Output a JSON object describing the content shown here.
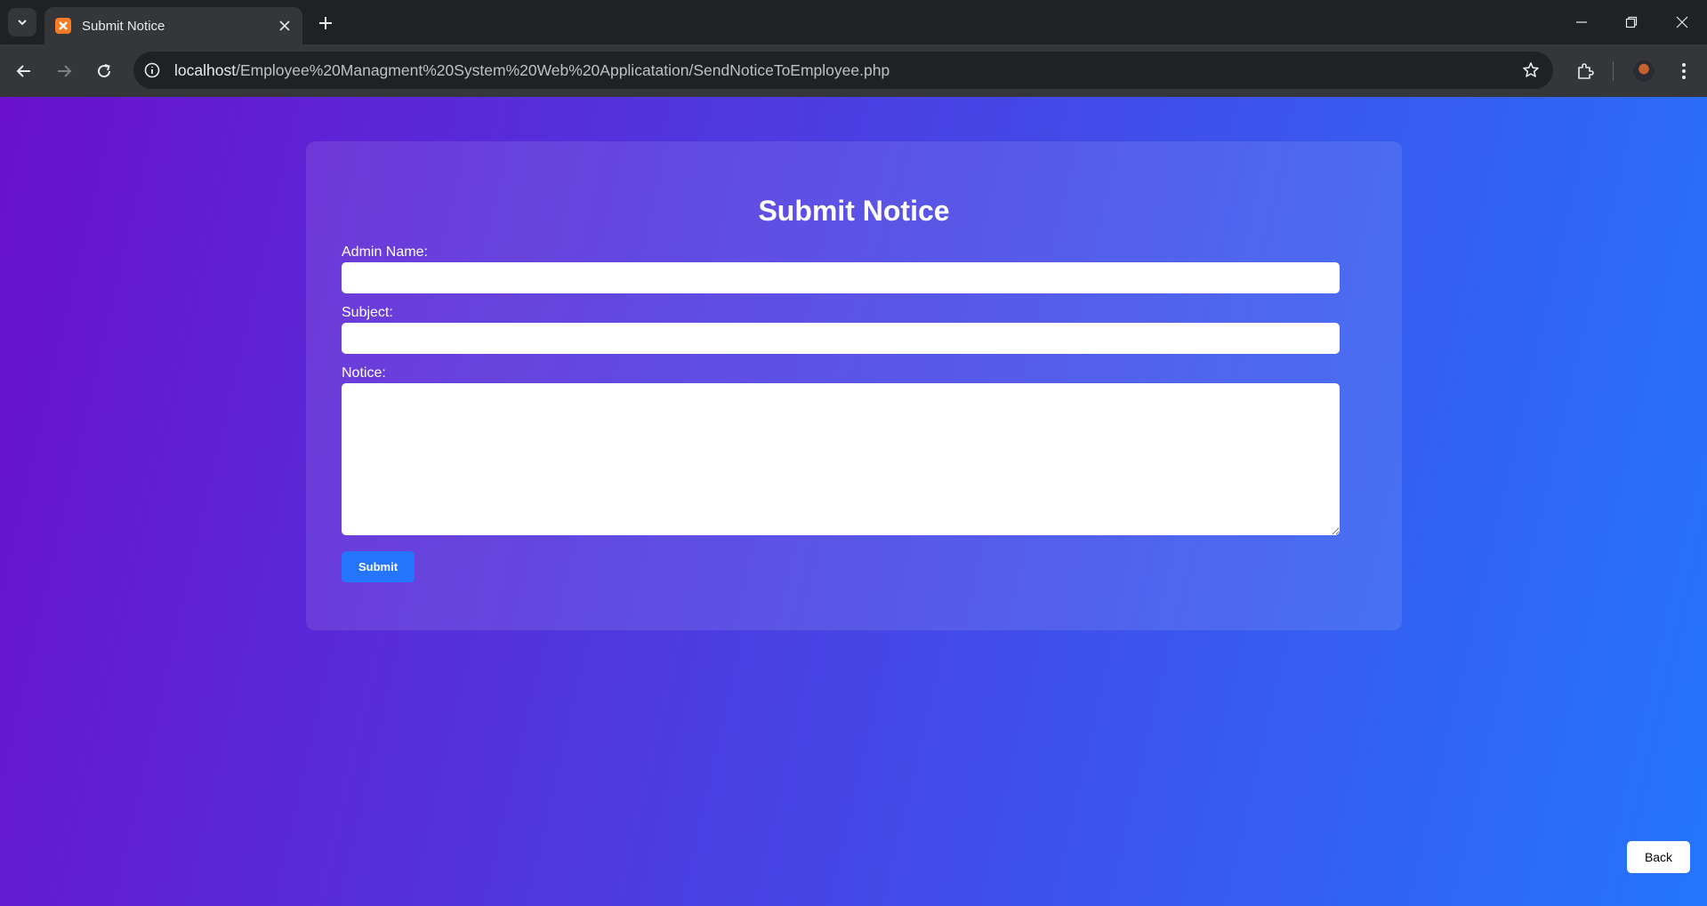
{
  "browser": {
    "tab_title": "Submit Notice",
    "url_host": "localhost",
    "url_path": "/Employee%20Managment%20System%20Web%20Applicatation/SendNoticeToEmployee.php"
  },
  "form": {
    "title": "Submit Notice",
    "admin_name_label": "Admin Name:",
    "admin_name_value": "",
    "subject_label": "Subject:",
    "subject_value": "",
    "notice_label": "Notice:",
    "notice_value": "",
    "submit_label": "Submit"
  },
  "back_label": "Back",
  "colors": {
    "gradient_start": "#6a11cb",
    "gradient_end": "#2575fc",
    "submit_button": "#2575fc"
  }
}
